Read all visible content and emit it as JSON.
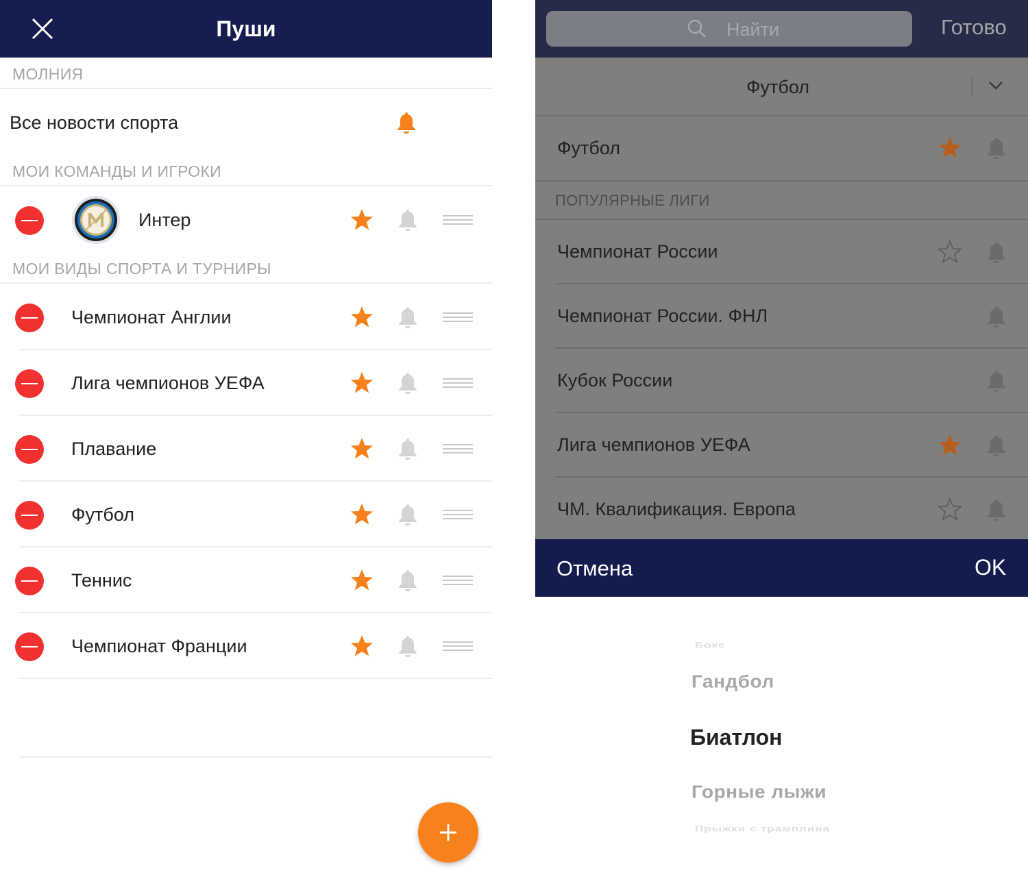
{
  "left": {
    "title": "Пуши",
    "sections": {
      "lightning": "МОЛНИЯ",
      "teams": "МОИ КОМАНДЫ И ИГРОКИ",
      "sports": "МОИ ВИДЫ СПОРТА И ТУРНИРЫ"
    },
    "all_news": "Все новости спорта",
    "team": "Интер",
    "sports": [
      "Чемпионат Англии",
      "Лига чемпионов УЕФА",
      "Плавание",
      "Футбол",
      "Теннис",
      "Чемпионат Франции"
    ]
  },
  "right": {
    "search_placeholder": "Найти",
    "done": "Готово",
    "sport_selector": "Футбол",
    "sport_row": "Футбол",
    "popular_label": "ПОПУЛЯРНЫЕ ЛИГИ",
    "leagues": [
      "Чемпионат России",
      "Чемпионат России. ФНЛ",
      "Кубок России",
      "Лига чемпионов УЕФА",
      "ЧМ. Квалификация. Европа"
    ],
    "cancel": "Отмена",
    "ok": "OK",
    "picker": [
      "Бокс",
      "Гандбол",
      "Биатлон",
      "Горные лыжи",
      "Прыжки с трамплина"
    ]
  },
  "colors": {
    "navy": "#151d4f",
    "orange": "#f7811b",
    "red": "#f0312f",
    "gray_icon": "#d4d4d4"
  },
  "icons": [
    "close-icon",
    "bell-icon",
    "star-icon",
    "star-outline-icon",
    "drag-handle-icon",
    "search-icon",
    "chevron-down-icon",
    "plus-icon",
    "inter-logo"
  ]
}
